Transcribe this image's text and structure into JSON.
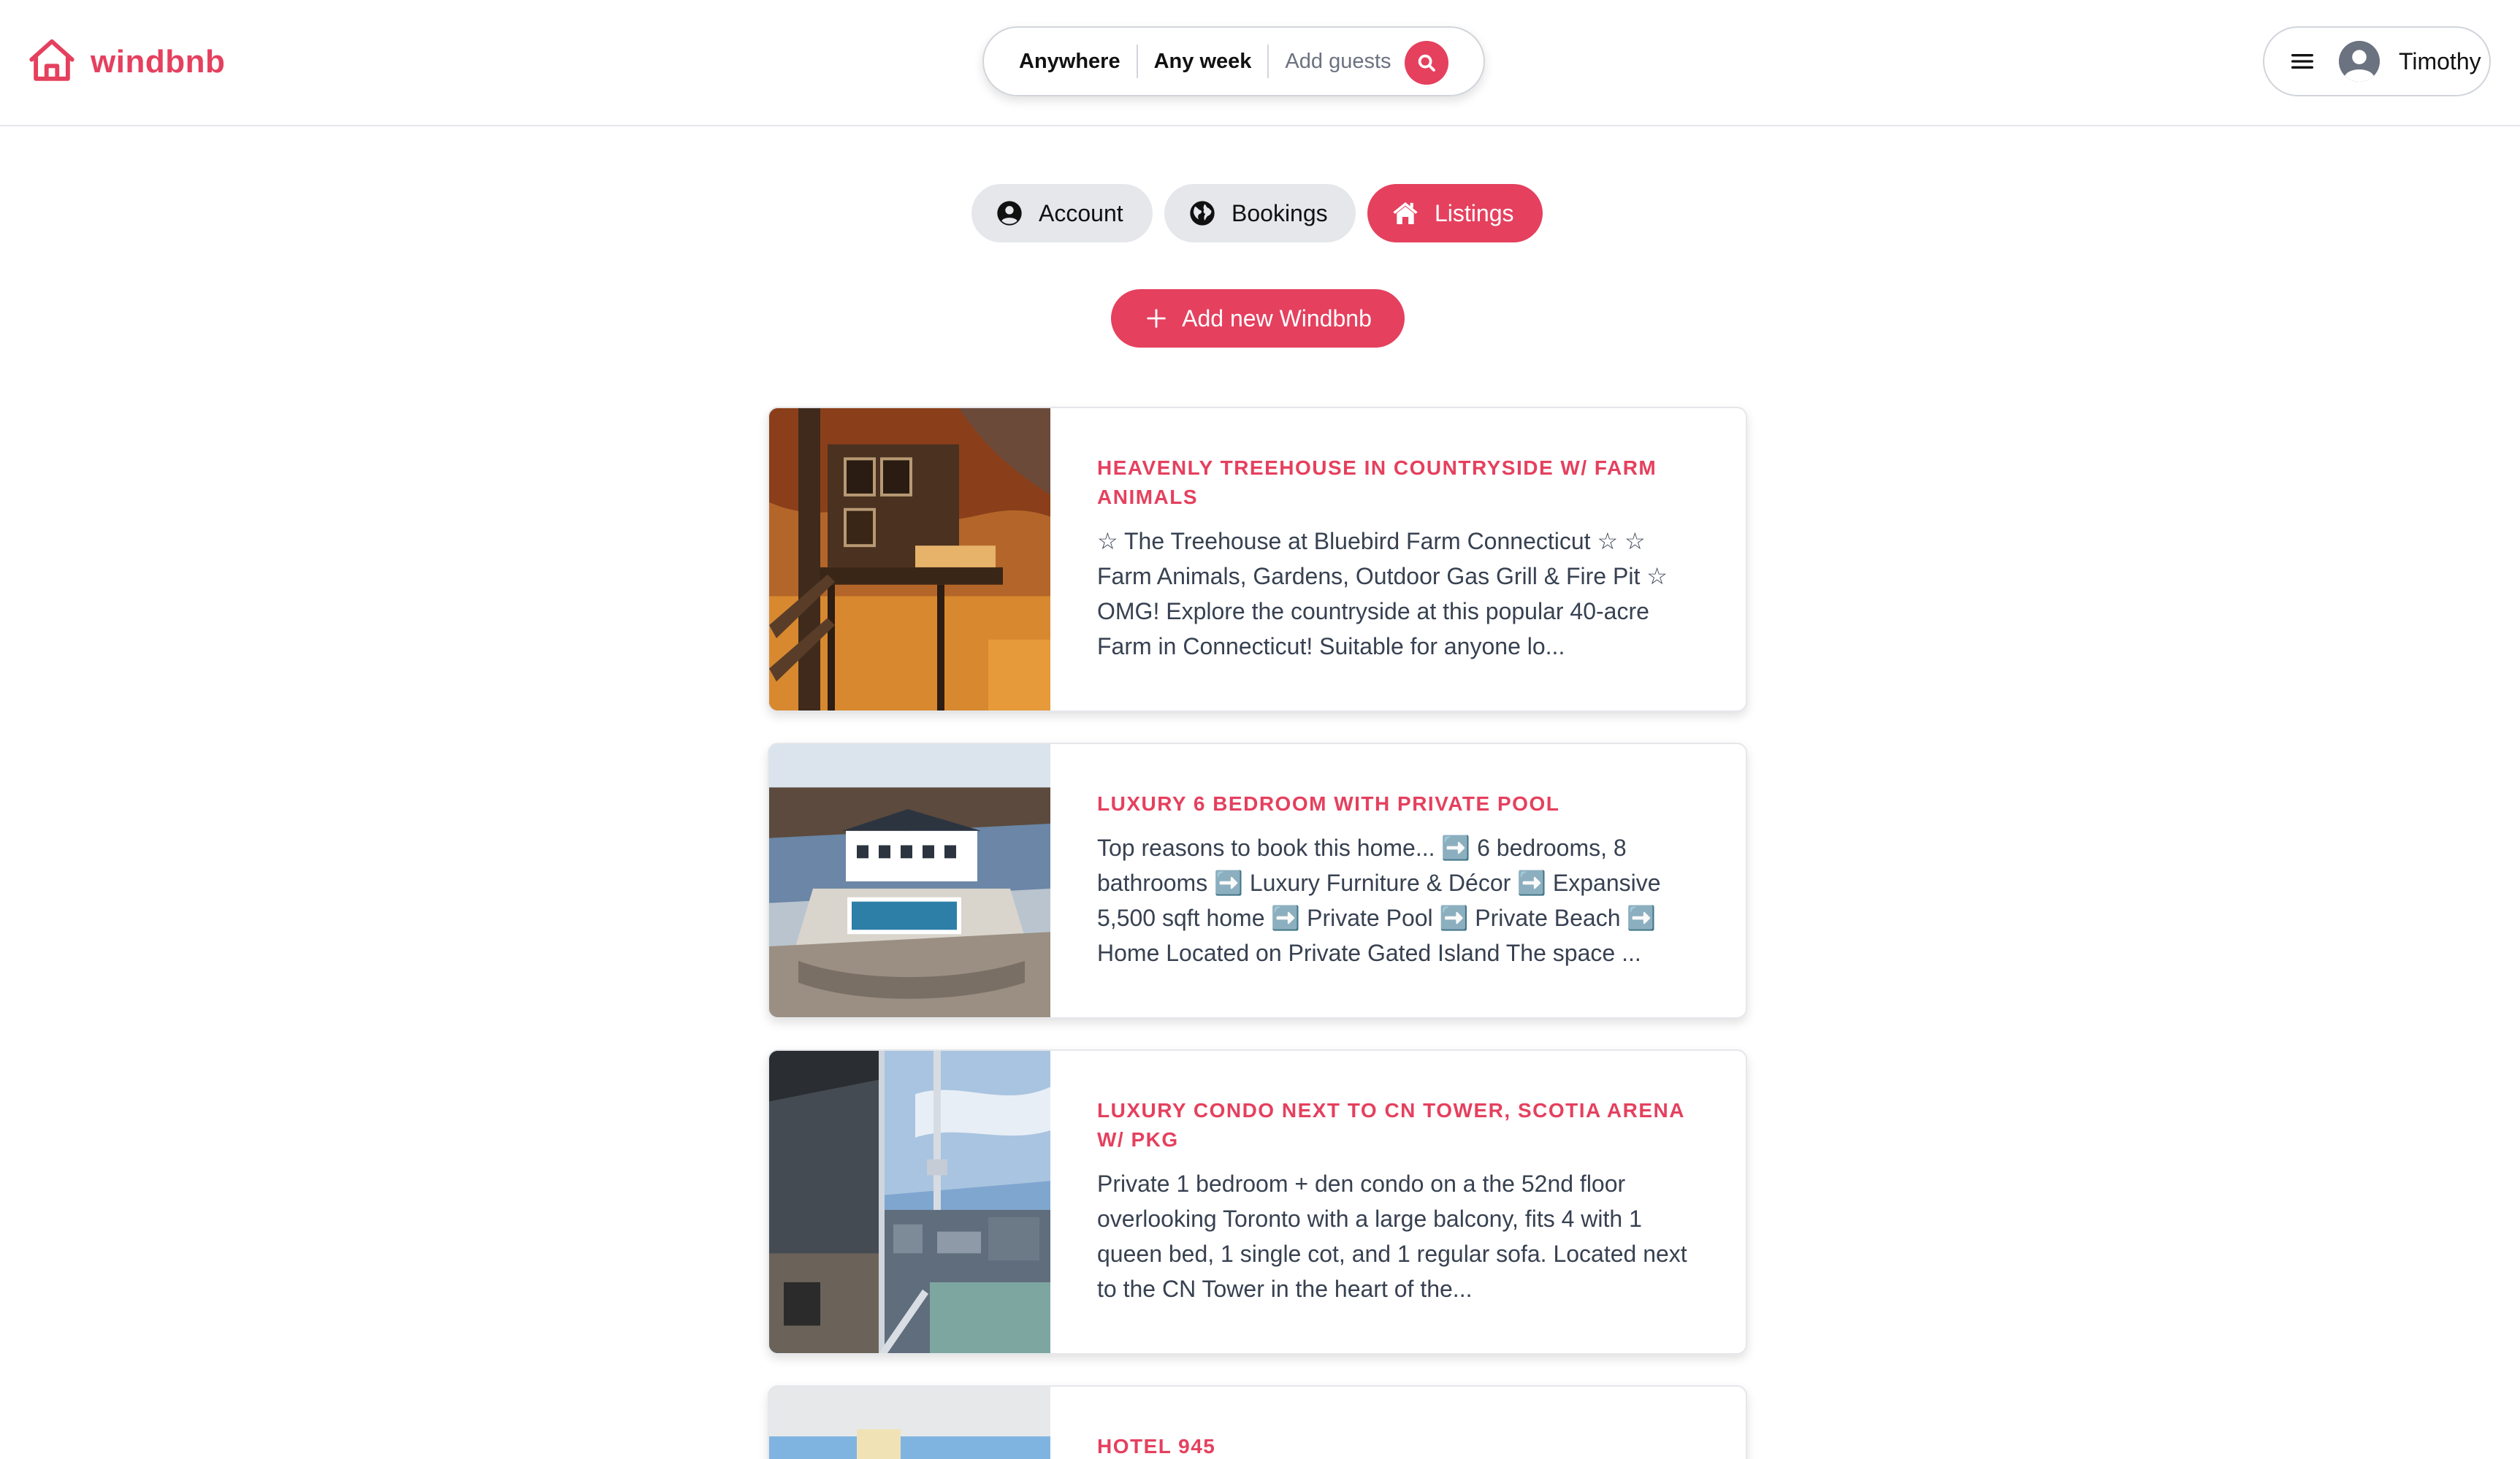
{
  "brand": {
    "name": "windbnb",
    "accent": "#e5405e"
  },
  "search": {
    "location": "Anywhere",
    "dates": "Any week",
    "guests_placeholder": "Add guests"
  },
  "user": {
    "name": "Timothy"
  },
  "tabs": [
    {
      "label": "Account",
      "icon": "user-circle-icon",
      "active": false
    },
    {
      "label": "Bookings",
      "icon": "globe-icon",
      "active": false
    },
    {
      "label": "Listings",
      "icon": "home-icon",
      "active": true
    }
  ],
  "add_listing_label": "Add new Windbnb",
  "listings": [
    {
      "title": "HEAVENLY TREEHOUSE IN COUNTRYSIDE W/ FARM ANIMALS",
      "description": "☆ The Treehouse at Bluebird Farm Connecticut ☆ ☆ Farm Animals, Gardens, Outdoor Gas Grill & Fire Pit ☆ OMG! Explore the countryside at this popular 40-acre Farm in Connecticut! Suitable for anyone lo..."
    },
    {
      "title": "LUXURY 6 BEDROOM WITH PRIVATE POOL",
      "description": "Top reasons to book this home... ➡️ 6 bedrooms, 8 bathrooms ➡️ Luxury Furniture & Décor ➡️ Expansive 5,500 sqft home ➡️ Private Pool ➡️ Private Beach ➡️ Home Located on Private Gated Island The space ..."
    },
    {
      "title": "LUXURY CONDO NEXT TO CN TOWER, SCOTIA ARENA W/ PKG",
      "description": "Private 1 bedroom + den condo on a the 52nd floor overlooking Toronto with a large balcony, fits 4 with 1 queen bed, 1 single cot, and 1 regular sofa. Located next to the CN Tower in the heart of the..."
    },
    {
      "title": "HOTEL 945",
      "description": ""
    }
  ]
}
